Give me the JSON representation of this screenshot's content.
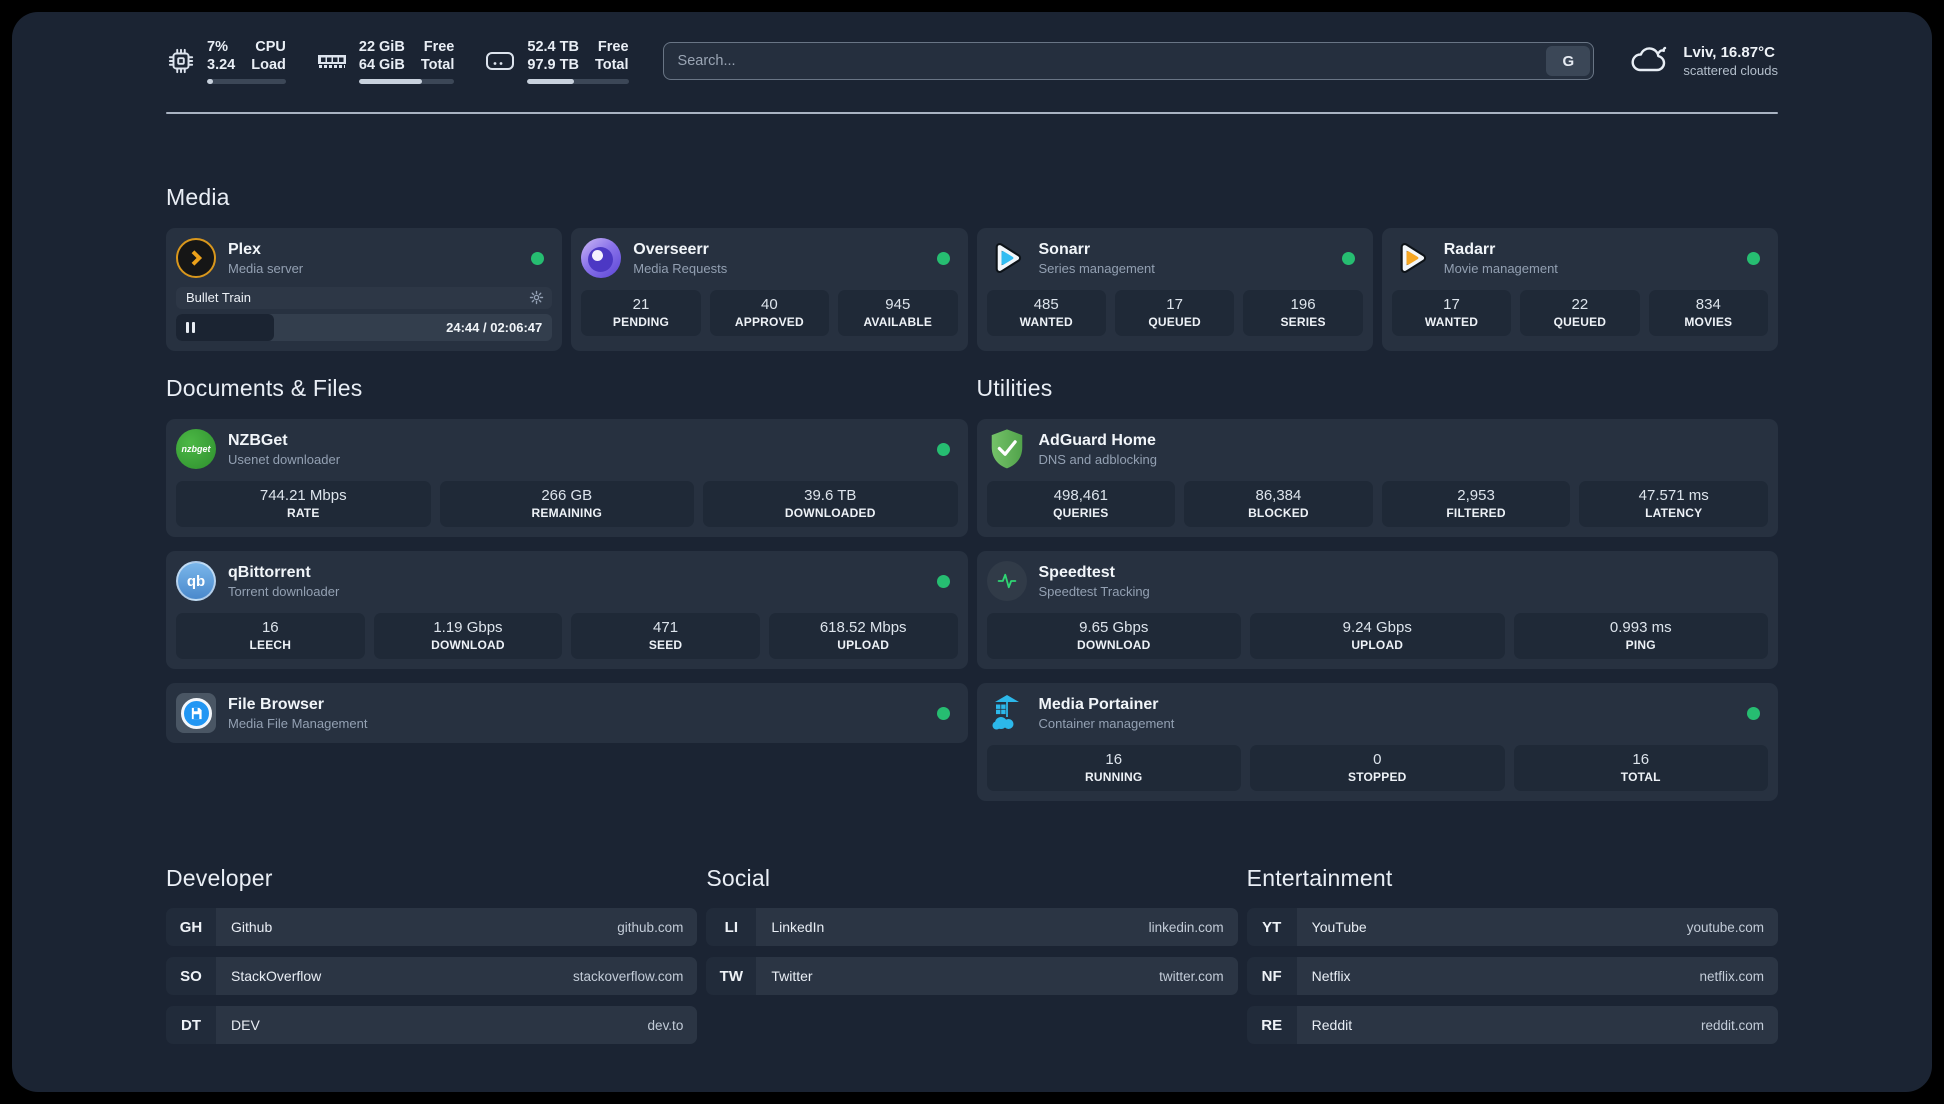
{
  "colors": {
    "panel_bg": "#1b2433",
    "card_bg": "#273140",
    "stat_bg": "#1f2937",
    "status_green": "#26bd71",
    "accent_blue": "#33bdf2",
    "accent_amber": "#f5a623"
  },
  "header": {
    "stats": [
      {
        "icon": "cpu-icon",
        "values": [
          "7%",
          "3.24"
        ],
        "labels": [
          "CPU",
          "Load"
        ],
        "progress_pct": 7
      },
      {
        "icon": "ram-icon",
        "values": [
          "22 GiB",
          "64 GiB"
        ],
        "labels": [
          "Free",
          "Total"
        ],
        "progress_pct": 66
      },
      {
        "icon": "disk-icon",
        "values": [
          "52.4 TB",
          "97.9 TB"
        ],
        "labels": [
          "Free",
          "Total"
        ],
        "progress_pct": 46
      }
    ],
    "search": {
      "placeholder": "Search...",
      "provider": "G"
    },
    "weather": {
      "icon": "cloud-icon",
      "title": "Lviv, 16.87°C",
      "subtitle": "scattered clouds"
    }
  },
  "sections": {
    "media": "Media",
    "documents": "Documents & Files",
    "utilities": "Utilities"
  },
  "apps": {
    "plex": {
      "icon": "plex-icon",
      "name": "Plex",
      "subtitle": "Media server",
      "online": true,
      "player": {
        "title": "Bullet Train",
        "time": "24:44 / 02:06:47",
        "progress_pct": 26
      }
    },
    "overseerr": {
      "icon": "overseerr-icon",
      "name": "Overseerr",
      "subtitle": "Media Requests",
      "online": true,
      "stats": [
        {
          "value": "21",
          "label": "PENDING"
        },
        {
          "value": "40",
          "label": "APPROVED"
        },
        {
          "value": "945",
          "label": "AVAILABLE"
        }
      ]
    },
    "sonarr": {
      "icon": "sonarr-icon",
      "name": "Sonarr",
      "subtitle": "Series management",
      "online": true,
      "stats": [
        {
          "value": "485",
          "label": "WANTED"
        },
        {
          "value": "17",
          "label": "QUEUED"
        },
        {
          "value": "196",
          "label": "SERIES"
        }
      ]
    },
    "radarr": {
      "icon": "radarr-icon",
      "name": "Radarr",
      "subtitle": "Movie management",
      "online": true,
      "stats": [
        {
          "value": "17",
          "label": "WANTED"
        },
        {
          "value": "22",
          "label": "QUEUED"
        },
        {
          "value": "834",
          "label": "MOVIES"
        }
      ]
    },
    "nzbget": {
      "icon": "nzbget-icon",
      "name": "NZBGet",
      "subtitle": "Usenet downloader",
      "online": true,
      "stats": [
        {
          "value": "744.21 Mbps",
          "label": "RATE"
        },
        {
          "value": "266 GB",
          "label": "REMAINING"
        },
        {
          "value": "39.6 TB",
          "label": "DOWNLOADED"
        }
      ]
    },
    "adguard": {
      "icon": "adguard-icon",
      "name": "AdGuard Home",
      "subtitle": "DNS and adblocking",
      "stats": [
        {
          "value": "498,461",
          "label": "QUERIES"
        },
        {
          "value": "86,384",
          "label": "BLOCKED"
        },
        {
          "value": "2,953",
          "label": "FILTERED"
        },
        {
          "value": "47.571 ms",
          "label": "LATENCY"
        }
      ]
    },
    "qbittorrent": {
      "icon": "qbittorrent-icon",
      "name": "qBittorrent",
      "subtitle": "Torrent downloader",
      "online": true,
      "stats": [
        {
          "value": "16",
          "label": "LEECH"
        },
        {
          "value": "1.19 Gbps",
          "label": "DOWNLOAD"
        },
        {
          "value": "471",
          "label": "SEED"
        },
        {
          "value": "618.52 Mbps",
          "label": "UPLOAD"
        }
      ]
    },
    "speedtest": {
      "icon": "speedtest-icon",
      "name": "Speedtest",
      "subtitle": "Speedtest Tracking",
      "stats": [
        {
          "value": "9.65 Gbps",
          "label": "DOWNLOAD"
        },
        {
          "value": "9.24 Gbps",
          "label": "UPLOAD"
        },
        {
          "value": "0.993 ms",
          "label": "PING"
        }
      ]
    },
    "filebrowser": {
      "icon": "filebrowser-icon",
      "name": "File Browser",
      "subtitle": "Media File Management",
      "online": true
    },
    "portainer": {
      "icon": "portainer-icon",
      "name": "Media Portainer",
      "subtitle": "Container management",
      "online": true,
      "stats": [
        {
          "value": "16",
          "label": "RUNNING"
        },
        {
          "value": "0",
          "label": "STOPPED"
        },
        {
          "value": "16",
          "label": "TOTAL"
        }
      ]
    }
  },
  "bookmarks": [
    {
      "title": "Developer",
      "items": [
        {
          "abbr": "GH",
          "name": "Github",
          "url": "github.com"
        },
        {
          "abbr": "SO",
          "name": "StackOverflow",
          "url": "stackoverflow.com"
        },
        {
          "abbr": "DT",
          "name": "DEV",
          "url": "dev.to"
        }
      ]
    },
    {
      "title": "Social",
      "items": [
        {
          "abbr": "LI",
          "name": "LinkedIn",
          "url": "linkedin.com"
        },
        {
          "abbr": "TW",
          "name": "Twitter",
          "url": "twitter.com"
        }
      ]
    },
    {
      "title": "Entertainment",
      "items": [
        {
          "abbr": "YT",
          "name": "YouTube",
          "url": "youtube.com"
        },
        {
          "abbr": "NF",
          "name": "Netflix",
          "url": "netflix.com"
        },
        {
          "abbr": "RE",
          "name": "Reddit",
          "url": "reddit.com"
        }
      ]
    }
  ]
}
